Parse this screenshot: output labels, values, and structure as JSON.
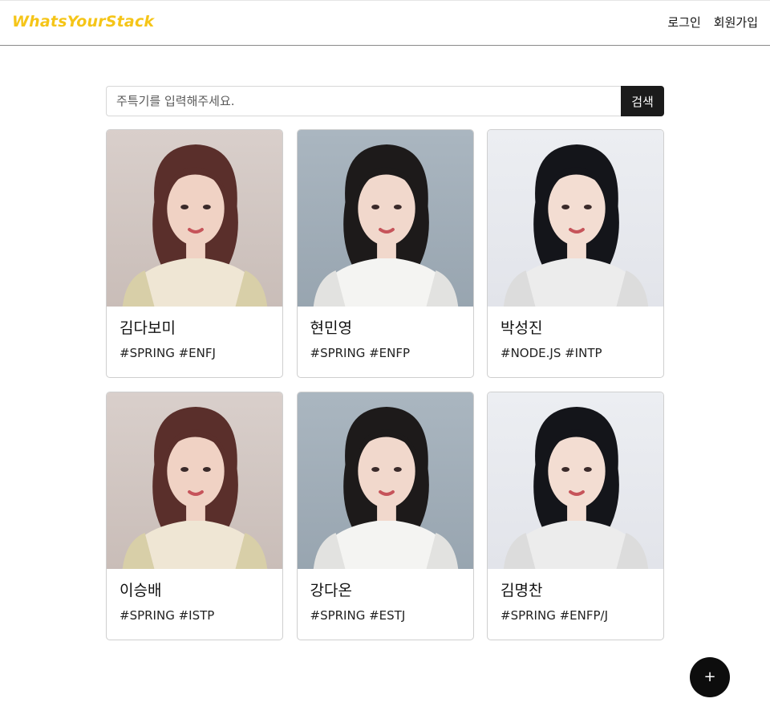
{
  "header": {
    "logo": "WhatsYourStack",
    "login": "로그인",
    "signup": "회원가입"
  },
  "search": {
    "placeholder": "주특기를 입력해주세요.",
    "value": "",
    "button": "검색"
  },
  "cards": [
    {
      "name": "김다보미",
      "tags": "#SPRING #ENFJ",
      "photo": "portrait-warm"
    },
    {
      "name": "현민영",
      "tags": "#SPRING #ENFP",
      "photo": "portrait-blue"
    },
    {
      "name": "박성진",
      "tags": "#NODE.JS #INTP",
      "photo": "portrait-white"
    },
    {
      "name": "이승배",
      "tags": "#SPRING #ISTP",
      "photo": "portrait-warm"
    },
    {
      "name": "강다온",
      "tags": "#SPRING #ESTJ",
      "photo": "portrait-blue"
    },
    {
      "name": "김명찬",
      "tags": "#SPRING #ENFP/J",
      "photo": "portrait-white"
    }
  ],
  "fab": {
    "label": "+"
  },
  "colors": {
    "logo": "#f5c518",
    "button": "#1b1b1b",
    "fab": "#0d0d0d"
  }
}
